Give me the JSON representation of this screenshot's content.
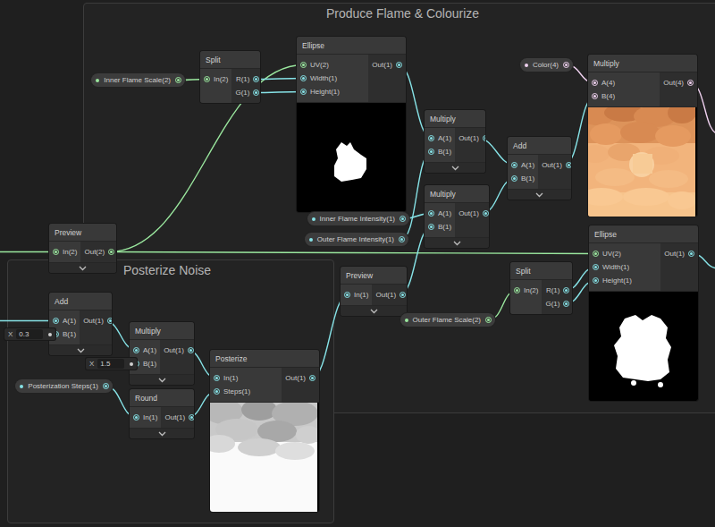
{
  "groups": [
    {
      "title": "Produce Flame & Colourize"
    },
    {
      "title": "Posterize Noise"
    }
  ],
  "nodes": [
    {
      "title": "Split",
      "inputs": [
        "In(2)"
      ],
      "outputs": [
        "R(1)",
        "G(1)"
      ],
      "chevron": false,
      "preview": "none"
    },
    {
      "title": "Ellipse",
      "inputs": [
        "UV(2)",
        "Width(1)",
        "Height(1)"
      ],
      "outputs": [
        "Out(1)"
      ],
      "chevron": false,
      "preview": "inner-flame-mask"
    },
    {
      "title": "Multiply",
      "inputs": [
        "A(1)",
        "B(1)"
      ],
      "outputs": [
        "Out(1)"
      ],
      "chevron": true,
      "preview": "none"
    },
    {
      "title": "Add",
      "inputs": [
        "A(1)",
        "B(1)"
      ],
      "outputs": [
        "Out(1)"
      ],
      "chevron": true,
      "preview": "none"
    },
    {
      "title": "Multiply",
      "inputs": [
        "A(1)",
        "B(1)"
      ],
      "outputs": [
        "Out(1)"
      ],
      "chevron": true,
      "preview": "none"
    },
    {
      "title": "Multiply",
      "inputs": [
        "A(4)",
        "B(4)"
      ],
      "outputs": [
        "Out(4)"
      ],
      "chevron": false,
      "preview": "colourized-flame"
    },
    {
      "title": "Ellipse",
      "inputs": [
        "UV(2)",
        "Width(1)",
        "Height(1)"
      ],
      "outputs": [
        "Out(1)"
      ],
      "chevron": false,
      "preview": "outer-flame-mask"
    },
    {
      "title": "Split",
      "inputs": [
        "In(2)"
      ],
      "outputs": [
        "R(1)",
        "G(1)"
      ],
      "chevron": false,
      "preview": "none"
    },
    {
      "title": "Preview",
      "inputs": [
        "In(2)"
      ],
      "outputs": [
        "Out(2)"
      ],
      "chevron": true,
      "preview": "none"
    },
    {
      "title": "Preview",
      "inputs": [
        "In(1)"
      ],
      "outputs": [
        "Out(1)"
      ],
      "chevron": true,
      "preview": "none"
    },
    {
      "title": "Add",
      "inputs": [
        "A(1)",
        "B(1)"
      ],
      "outputs": [
        "Out(1)"
      ],
      "chevron": true,
      "preview": "none"
    },
    {
      "title": "Multiply",
      "inputs": [
        "A(1)",
        "B(1)"
      ],
      "outputs": [
        "Out(1)"
      ],
      "chevron": true,
      "preview": "none"
    },
    {
      "title": "Round",
      "inputs": [
        "In(1)"
      ],
      "outputs": [
        "Out(1)"
      ],
      "chevron": true,
      "preview": "none"
    },
    {
      "title": "Posterize",
      "inputs": [
        "In(1)",
        "Steps(1)"
      ],
      "outputs": [
        "Out(1)"
      ],
      "chevron": false,
      "preview": "posterized-noise"
    }
  ],
  "properties": [
    {
      "label": "Inner Flame Scale(2)"
    },
    {
      "label": "Color(4)"
    },
    {
      "label": "Inner Flame Intensity(1)"
    },
    {
      "label": "Outer Flame Intensity(1)"
    },
    {
      "label": "Outer Flame Scale(2)"
    },
    {
      "label": "Posterization Steps(1)"
    }
  ],
  "inline_values": [
    {
      "axis": "X",
      "value": "0.3"
    },
    {
      "axis": "X",
      "value": "1.5"
    }
  ]
}
